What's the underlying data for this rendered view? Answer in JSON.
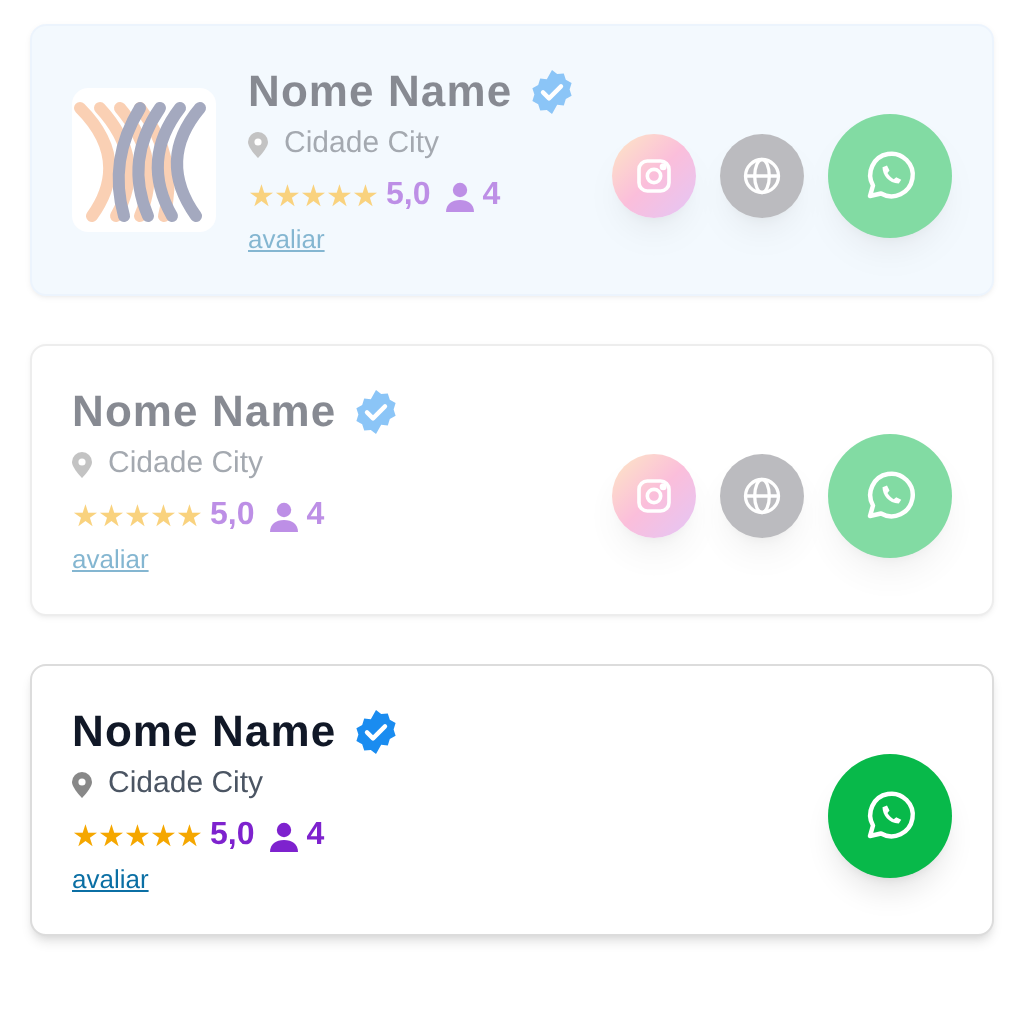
{
  "cards": [
    {
      "tinted": true,
      "faded": true,
      "logo": true,
      "name": "Nome Name",
      "verified": true,
      "city": "Cidade City",
      "stars": 5,
      "rating": "5,0",
      "count": "4",
      "link": "avaliar",
      "buttons": [
        {
          "kind": "instagram"
        },
        {
          "kind": "web"
        },
        {
          "kind": "whatsapp"
        }
      ]
    },
    {
      "tinted": false,
      "faded": true,
      "logo": false,
      "name": "Nome Name",
      "verified": true,
      "city": "Cidade City",
      "stars": 5,
      "rating": "5,0",
      "count": "4",
      "link": "avaliar",
      "buttons": [
        {
          "kind": "instagram"
        },
        {
          "kind": "web"
        },
        {
          "kind": "whatsapp"
        }
      ]
    },
    {
      "tinted": false,
      "faded": false,
      "logo": false,
      "name": "Nome Name",
      "verified": true,
      "city": "Cidade City",
      "stars": 5,
      "rating": "5,0",
      "count": "4",
      "link": "avaliar",
      "buttons": [
        {
          "kind": "whatsapp"
        }
      ]
    }
  ]
}
